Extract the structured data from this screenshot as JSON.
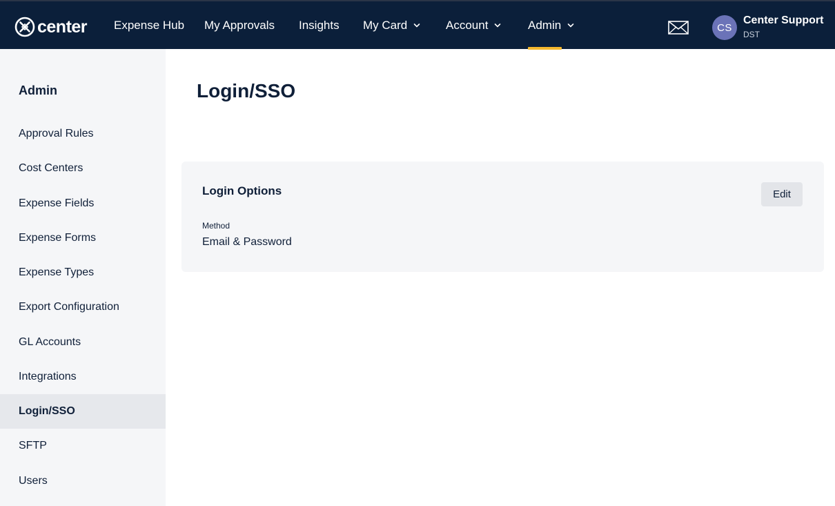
{
  "app": {
    "brand": "center"
  },
  "nav": {
    "items": [
      {
        "label": "Expense Hub",
        "dropdown": false
      },
      {
        "label": "My Approvals",
        "dropdown": false
      },
      {
        "label": "Insights",
        "dropdown": false
      },
      {
        "label": "My Card",
        "dropdown": true
      },
      {
        "label": "Account",
        "dropdown": true
      },
      {
        "label": "Admin",
        "dropdown": true,
        "active": true
      }
    ],
    "active_color": "#f5b82e"
  },
  "user": {
    "initials": "CS",
    "name": "Center Support",
    "org": "DST",
    "avatar_color": "#6b73b8"
  },
  "sidebar": {
    "title": "Admin",
    "items": [
      {
        "label": "Approval Rules"
      },
      {
        "label": "Cost Centers"
      },
      {
        "label": "Expense Fields"
      },
      {
        "label": "Expense Forms"
      },
      {
        "label": "Expense Types"
      },
      {
        "label": "Export Configuration"
      },
      {
        "label": "GL Accounts"
      },
      {
        "label": "Integrations"
      },
      {
        "label": "Login/SSO",
        "active": true
      },
      {
        "label": "SFTP"
      },
      {
        "label": "Users"
      }
    ]
  },
  "main": {
    "title": "Login/SSO",
    "card": {
      "title": "Login Options",
      "edit_label": "Edit",
      "field_label": "Method",
      "field_value": "Email & Password"
    }
  },
  "icons": {
    "logo": "center-logo-icon",
    "mail": "mail-icon",
    "chevron": "chevron-down-icon"
  }
}
